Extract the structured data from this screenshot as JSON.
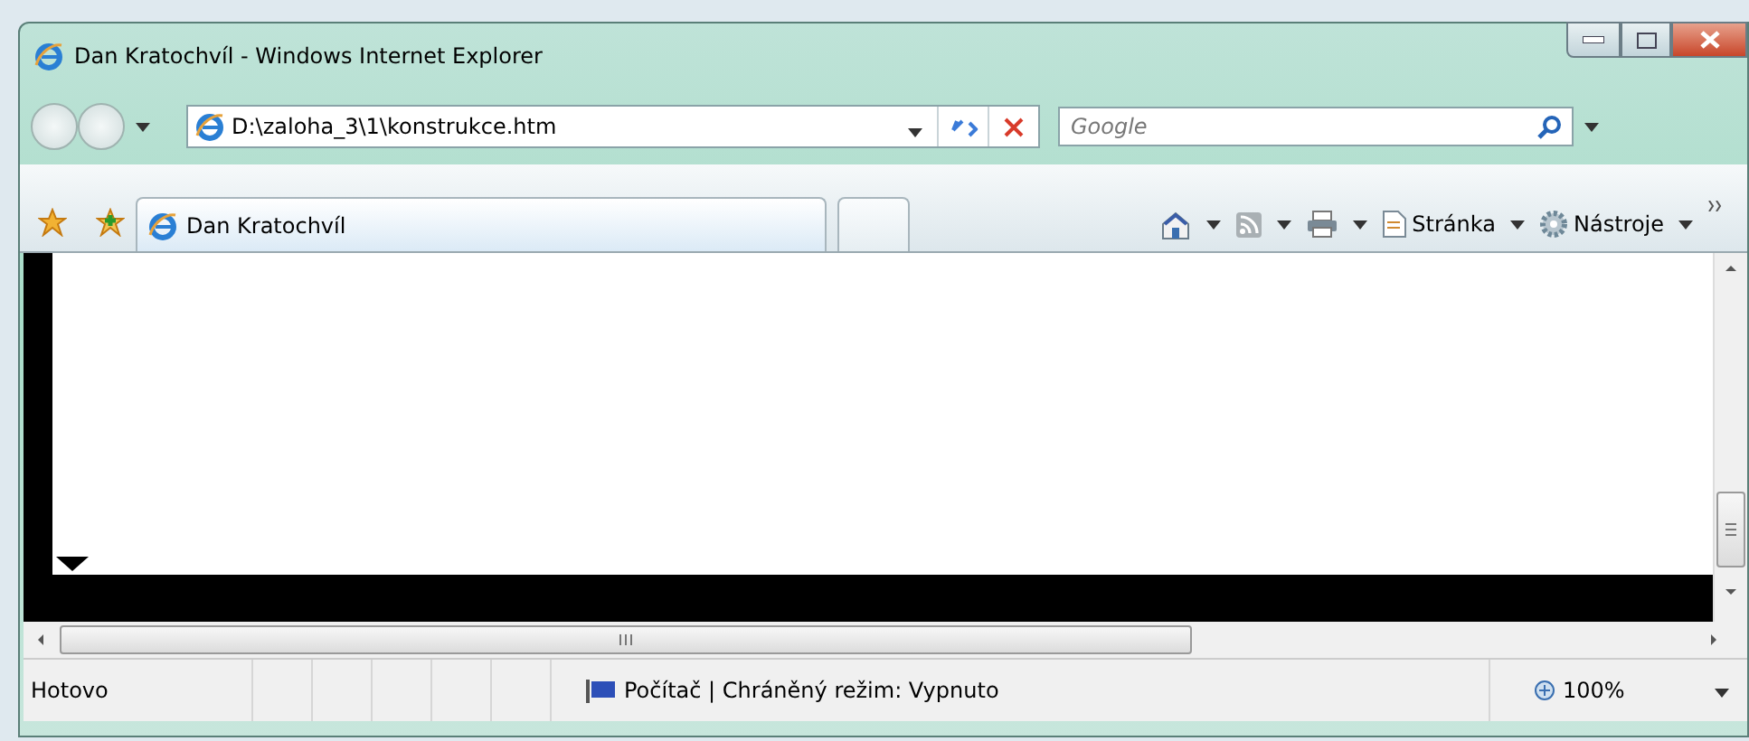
{
  "window": {
    "title": "Dan Kratochvíl - Windows Internet Explorer"
  },
  "address_bar": {
    "value": "D:\\zaloha_3\\1\\konstrukce.htm"
  },
  "search": {
    "placeholder": "Google"
  },
  "tabs": [
    {
      "label": "Dan Kratochvíl",
      "selected": true
    },
    {
      "selected": false
    }
  ],
  "command_bar": [
    {
      "kind": "home"
    },
    {
      "kind": "feeds",
      "disabled": true
    },
    {
      "kind": "print"
    },
    {
      "kind": "page",
      "label": "Stránka"
    },
    {
      "kind": "tools",
      "label": "Nástroje"
    }
  ],
  "status_bar": {
    "status": "Hotovo",
    "zone": "Počítač | Chráněný režim: Vypnuto",
    "zoom": "100%"
  }
}
